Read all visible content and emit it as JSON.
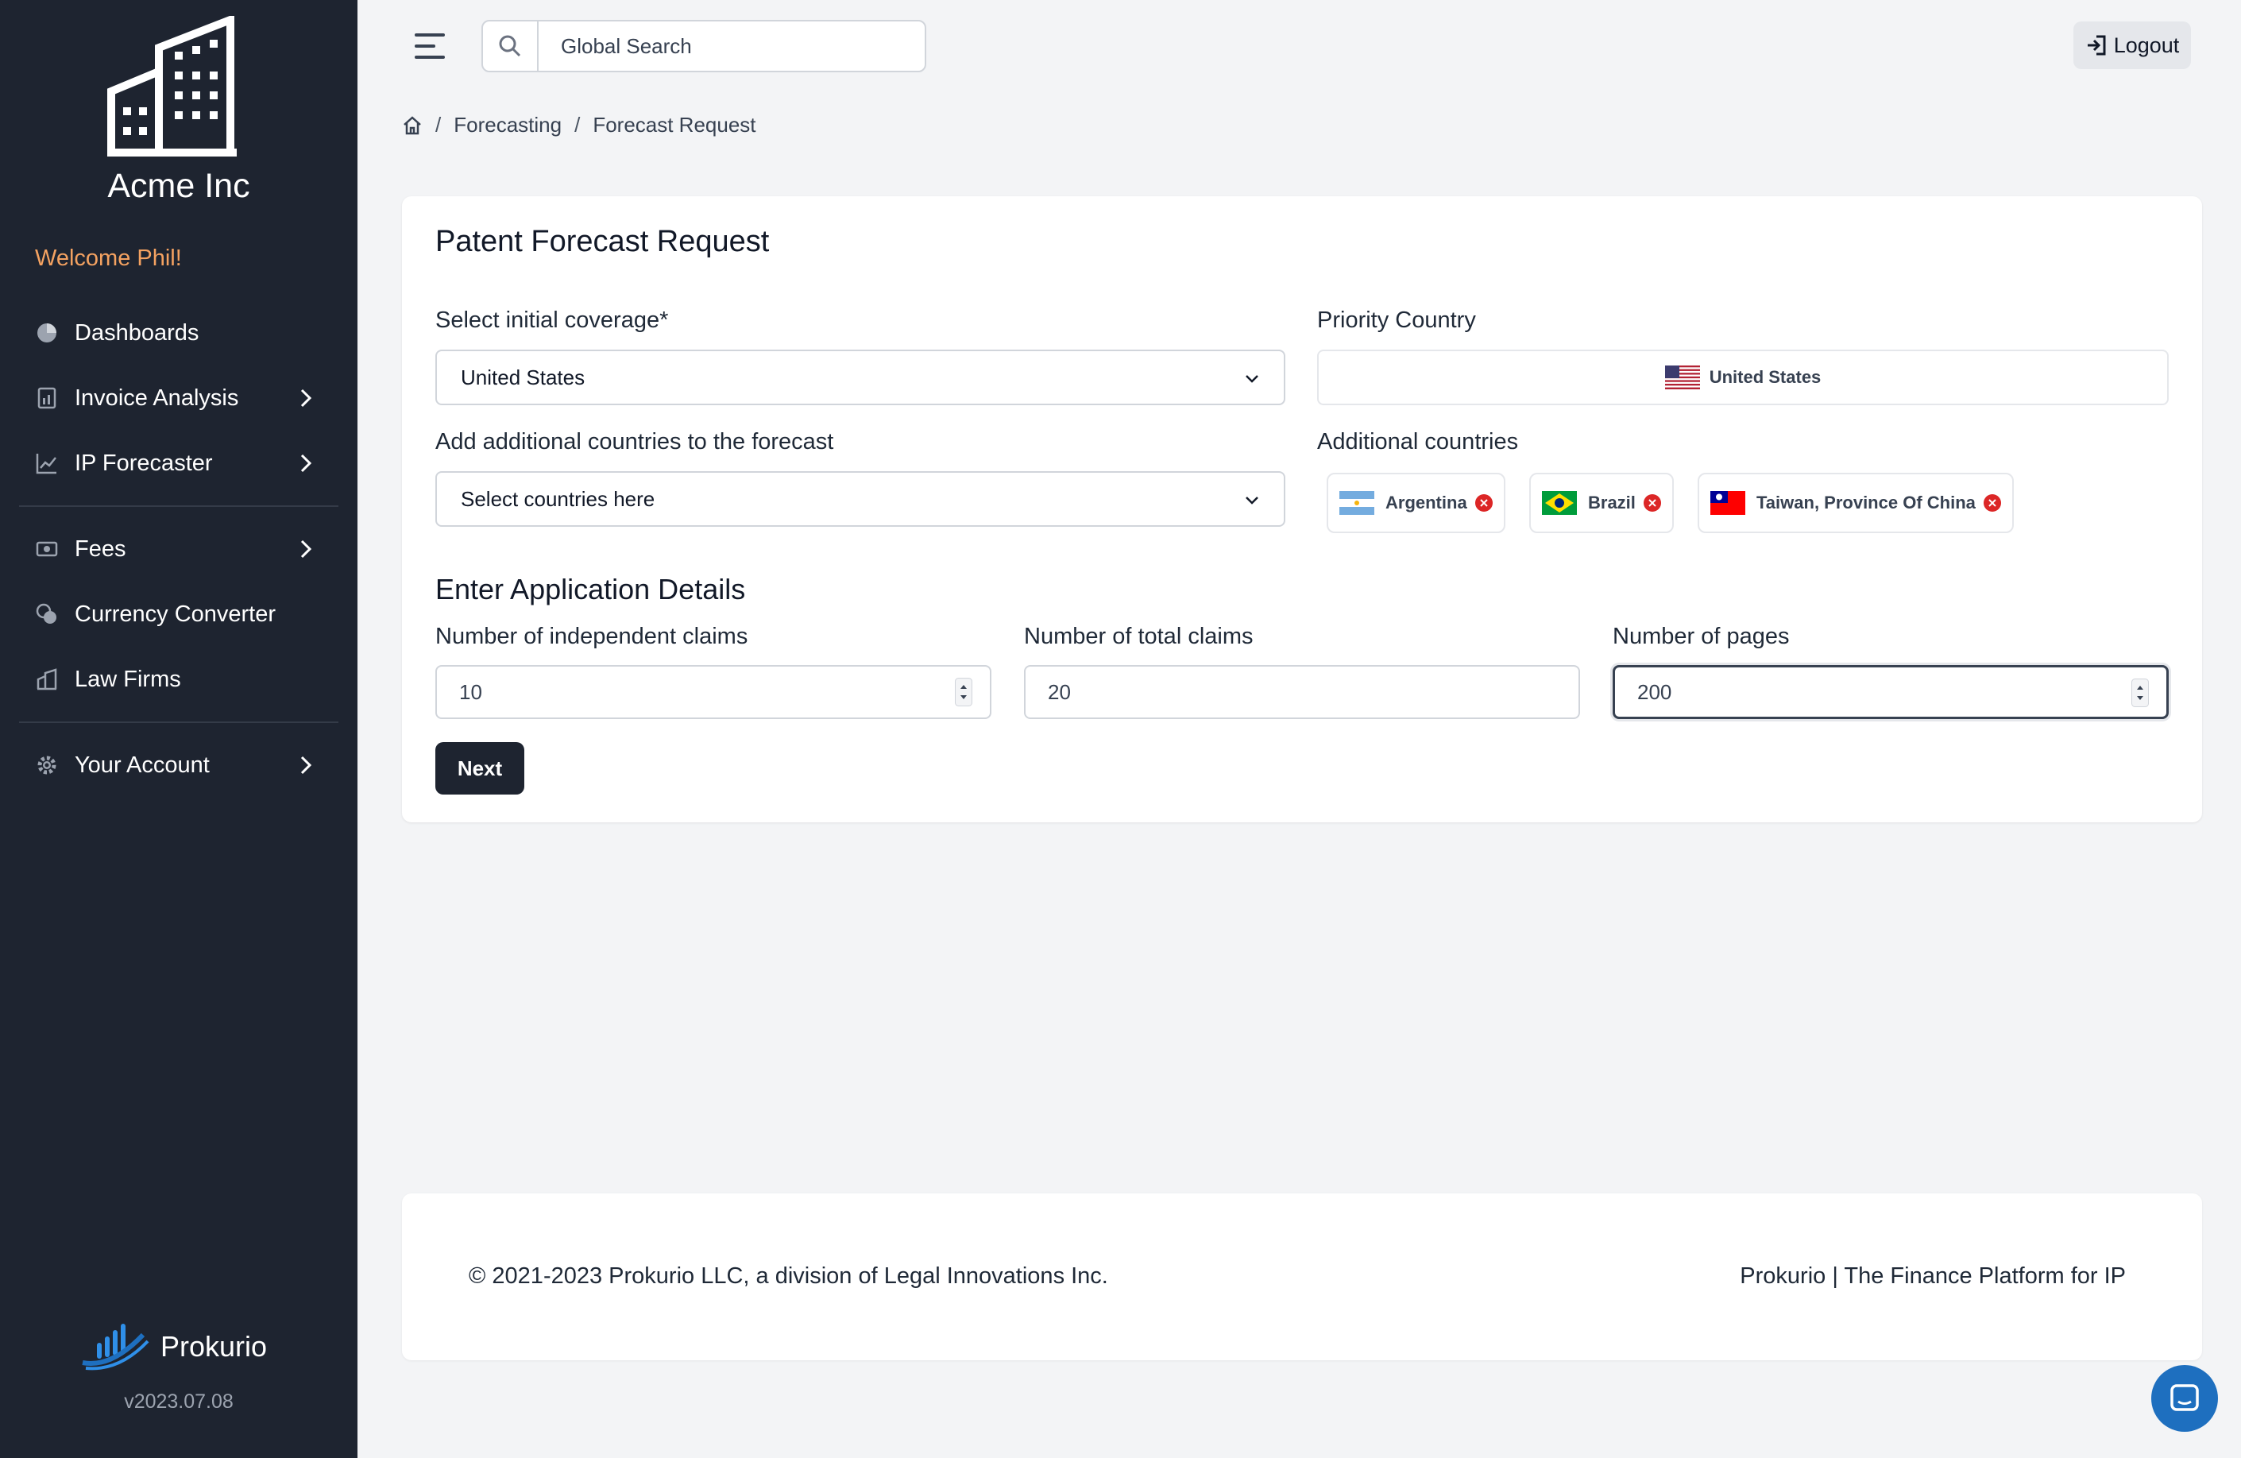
{
  "sidebar": {
    "company": "Acme Inc",
    "welcome": "Welcome Phil!",
    "items": [
      {
        "label": "Dashboards",
        "icon": "pie-chart-icon"
      },
      {
        "label": "Invoice Analysis",
        "icon": "invoice-icon"
      },
      {
        "label": "IP Forecaster",
        "icon": "trend-icon"
      },
      {
        "label": "Fees",
        "icon": "cash-icon"
      },
      {
        "label": "Currency Converter",
        "icon": "coins-icon"
      },
      {
        "label": "Law Firms",
        "icon": "building-icon"
      },
      {
        "label": "Your Account",
        "icon": "gear-icon"
      }
    ],
    "brand": "Prokurio",
    "version": "v2023.07.08"
  },
  "topbar": {
    "search_placeholder": "Global Search",
    "logout": "Logout"
  },
  "breadcrumb": {
    "items": [
      "Forecasting",
      "Forecast Request"
    ]
  },
  "form": {
    "title": "Patent Forecast Request",
    "initial_coverage_label": "Select initial coverage*",
    "initial_coverage_value": "United States",
    "priority_label": "Priority Country",
    "priority_value": "United States",
    "additional_label": "Add additional countries to the forecast",
    "additional_placeholder": "Select countries here",
    "additional_countries_label": "Additional countries",
    "chips": [
      "Argentina",
      "Brazil",
      "Taiwan, Province Of China"
    ],
    "details_title": "Enter Application Details",
    "independent_claims_label": "Number of independent claims",
    "independent_claims_value": "10",
    "total_claims_label": "Number of total claims",
    "total_claims_value": "20",
    "pages_label": "Number of pages",
    "pages_value": "200",
    "next": "Next"
  },
  "footer": {
    "copyright": "© 2021-2023 Prokurio LLC, a division of Legal Innovations Inc.",
    "tagline": "Prokurio | The Finance Platform for IP"
  },
  "colors": {
    "sidebar_bg": "#1e2430",
    "welcome": "#f4a261",
    "chat": "#1e6fbf"
  }
}
